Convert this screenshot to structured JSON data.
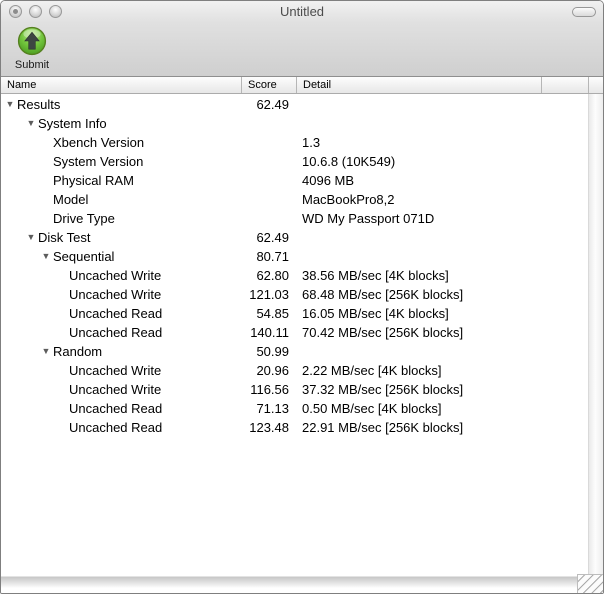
{
  "window": {
    "title": "Untitled"
  },
  "toolbar": {
    "submit_label": "Submit"
  },
  "icons": {
    "submit": "green-up-arrow-circle",
    "disclosure_glyph": "▼",
    "close_button": "gray-circle-with-dot",
    "minimize_button": "gray-circle",
    "zoom_button": "gray-circle",
    "toolbar_toggle": "pill-oval",
    "resize_grip": "diagonal-lines"
  },
  "colors": {
    "accent_green": "#5fb32d",
    "accent_green_dark": "#3f9018",
    "toolbar_top": "#e0e0e0",
    "toolbar_bottom": "#cfcfcf",
    "header_border": "#ababab",
    "row_text": "#000000",
    "triangle": "#5c5c5c"
  },
  "table": {
    "columns": [
      "Name",
      "Score",
      "Detail"
    ],
    "rows": [
      {
        "level": 0,
        "expanded": true,
        "name": "Results",
        "score": "62.49",
        "detail": ""
      },
      {
        "level": 1,
        "expanded": true,
        "name": "System Info",
        "score": "",
        "detail": ""
      },
      {
        "level": 2,
        "expanded": false,
        "name": "Xbench Version",
        "score": "",
        "detail": "1.3"
      },
      {
        "level": 2,
        "expanded": false,
        "name": "System Version",
        "score": "",
        "detail": "10.6.8 (10K549)"
      },
      {
        "level": 2,
        "expanded": false,
        "name": "Physical RAM",
        "score": "",
        "detail": "4096 MB"
      },
      {
        "level": 2,
        "expanded": false,
        "name": "Model",
        "score": "",
        "detail": "MacBookPro8,2"
      },
      {
        "level": 2,
        "expanded": false,
        "name": "Drive Type",
        "score": "",
        "detail": "WD My Passport 071D"
      },
      {
        "level": 1,
        "expanded": true,
        "name": "Disk Test",
        "score": "62.49",
        "detail": ""
      },
      {
        "level": 2,
        "expanded": true,
        "name": "Sequential",
        "score": "80.71",
        "detail": ""
      },
      {
        "level": 3,
        "expanded": false,
        "name": "Uncached Write",
        "score": "62.80",
        "detail": "38.56 MB/sec [4K blocks]"
      },
      {
        "level": 3,
        "expanded": false,
        "name": "Uncached Write",
        "score": "121.03",
        "detail": "68.48 MB/sec [256K blocks]"
      },
      {
        "level": 3,
        "expanded": false,
        "name": "Uncached Read",
        "score": "54.85",
        "detail": "16.05 MB/sec [4K blocks]"
      },
      {
        "level": 3,
        "expanded": false,
        "name": "Uncached Read",
        "score": "140.11",
        "detail": "70.42 MB/sec [256K blocks]"
      },
      {
        "level": 2,
        "expanded": true,
        "name": "Random",
        "score": "50.99",
        "detail": ""
      },
      {
        "level": 3,
        "expanded": false,
        "name": "Uncached Write",
        "score": "20.96",
        "detail": "2.22 MB/sec [4K blocks]"
      },
      {
        "level": 3,
        "expanded": false,
        "name": "Uncached Write",
        "score": "116.56",
        "detail": "37.32 MB/sec [256K blocks]"
      },
      {
        "level": 3,
        "expanded": false,
        "name": "Uncached Read",
        "score": "71.13",
        "detail": "0.50 MB/sec [4K blocks]"
      },
      {
        "level": 3,
        "expanded": false,
        "name": "Uncached Read",
        "score": "123.48",
        "detail": "22.91 MB/sec [256K blocks]"
      }
    ]
  }
}
